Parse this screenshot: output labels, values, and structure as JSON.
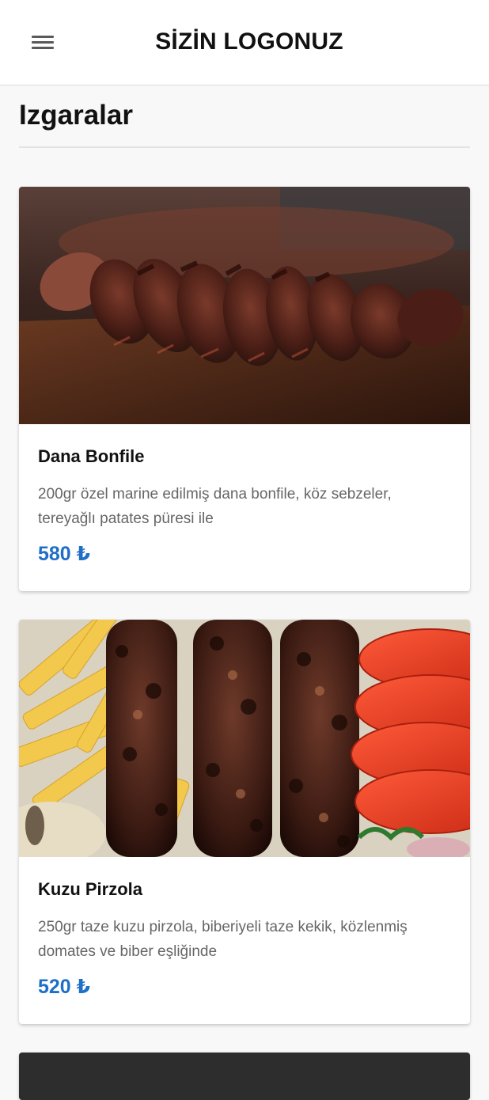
{
  "header": {
    "logo": "SİZİN LOGONUZ",
    "menu_icon": "hamburger-menu-icon"
  },
  "section": {
    "title": "Izgaralar"
  },
  "items": [
    {
      "name": "Dana Bonfile",
      "description": "200gr özel marine edilmiş dana bonfile, köz sebzeler, tereyağlı patates püresi ile",
      "price": "580 ₺",
      "image": "sliced-grilled-steak-photo"
    },
    {
      "name": "Kuzu Pirzola",
      "description": "250gr taze kuzu pirzola, biberiyeli taze kekik, közlenmiş domates ve biber eşliğinde",
      "price": "520 ₺",
      "image": "grilled-skewers-fries-tomatoes-photo"
    }
  ],
  "colors": {
    "price": "#1f6fc7",
    "header_bg": "#ffffff",
    "page_bg": "#f8f8f8",
    "dark_card": "#2d2d2d"
  }
}
